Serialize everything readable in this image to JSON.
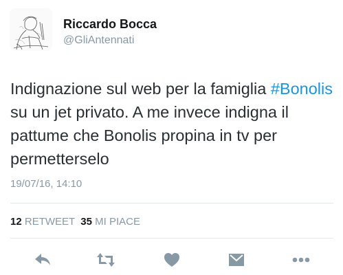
{
  "user": {
    "name": "Riccardo Bocca",
    "handle": "@GliAntennati"
  },
  "tweet": {
    "segments": [
      {
        "text": "Indignazione sul web per la famiglia ",
        "type": "text"
      },
      {
        "text": "#Bonolis",
        "type": "hashtag"
      },
      {
        "text": " su un jet privato. A me invece indigna il pattume che Bonolis propina in tv per permetterselo",
        "type": "text"
      }
    ],
    "timestamp": "19/07/16, 14:10"
  },
  "stats": {
    "retweets_count": "12",
    "retweets_label": "RETWEET",
    "likes_count": "35",
    "likes_label": "MI PIACE"
  },
  "actions": [
    {
      "name": "reply-icon"
    },
    {
      "name": "retweet-icon"
    },
    {
      "name": "like-icon"
    },
    {
      "name": "direct-message-icon"
    },
    {
      "name": "more-icon"
    }
  ],
  "colors": {
    "hashtag": "#1b95e0",
    "icon": "#8899a6",
    "divider": "#e1e8ed"
  }
}
